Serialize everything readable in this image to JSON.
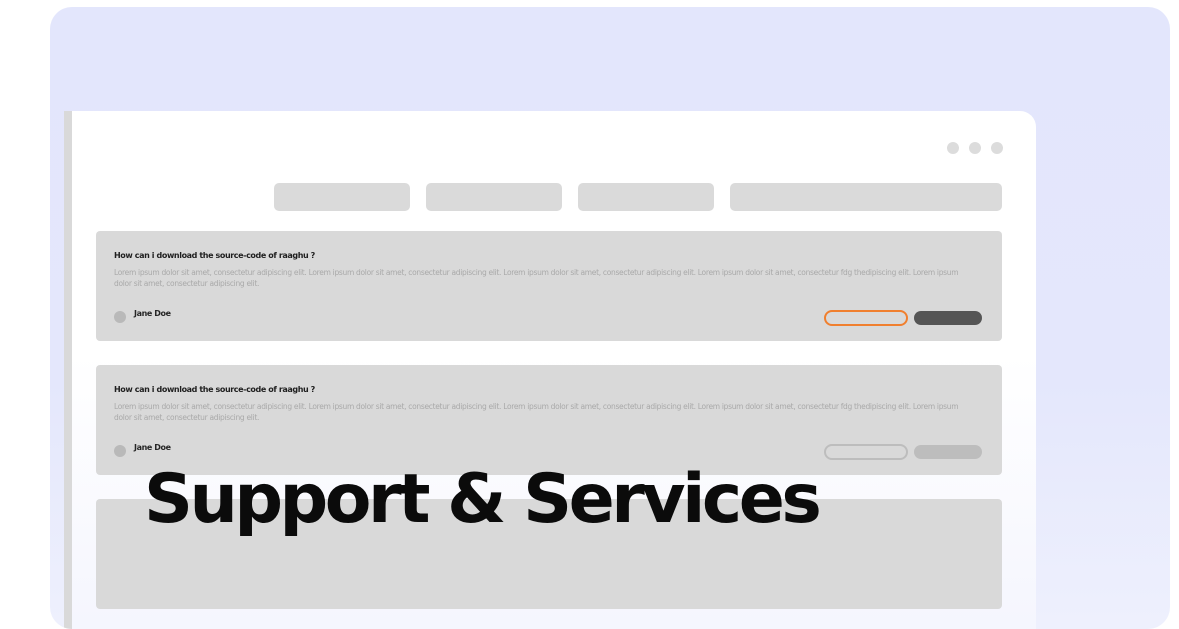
{
  "headline": "Support & Services",
  "colors": {
    "background_card": "#e3e6fc",
    "window": "#ffffff",
    "placeholder": "#d9d9d9",
    "accent_outline": "#f07f2e",
    "primary_button": "#555555",
    "headline_text": "#0b0b0b"
  },
  "window": {
    "controls": [
      "dot",
      "dot",
      "dot"
    ],
    "tabs": [
      "",
      "",
      "",
      ""
    ]
  },
  "questions": [
    {
      "title": "How can i download the source-code of raaghu ?",
      "body": "Lorem ipsum dolor sit amet, consectetur adipiscing elit. Lorem ipsum dolor sit amet, consectetur adipiscing elit. Lorem ipsum dolor sit amet, consectetur adipiscing elit. Lorem ipsum dolor sit amet, consectetur fdg thedipiscing elit. Lorem ipsum dolor sit amet, consectetur adipiscing elit.",
      "author": "Jane Doe",
      "state": "active"
    },
    {
      "title": "How can i download the source-code of raaghu ?",
      "body": "Lorem ipsum dolor sit amet, consectetur adipiscing elit. Lorem ipsum dolor sit amet, consectetur adipiscing elit. Lorem ipsum dolor sit amet, consectetur adipiscing elit. Lorem ipsum dolor sit amet, consectetur fdg thedipiscing elit. Lorem ipsum dolor sit amet, consectetur adipiscing elit.",
      "author": "Jane Doe",
      "state": "muted"
    }
  ]
}
